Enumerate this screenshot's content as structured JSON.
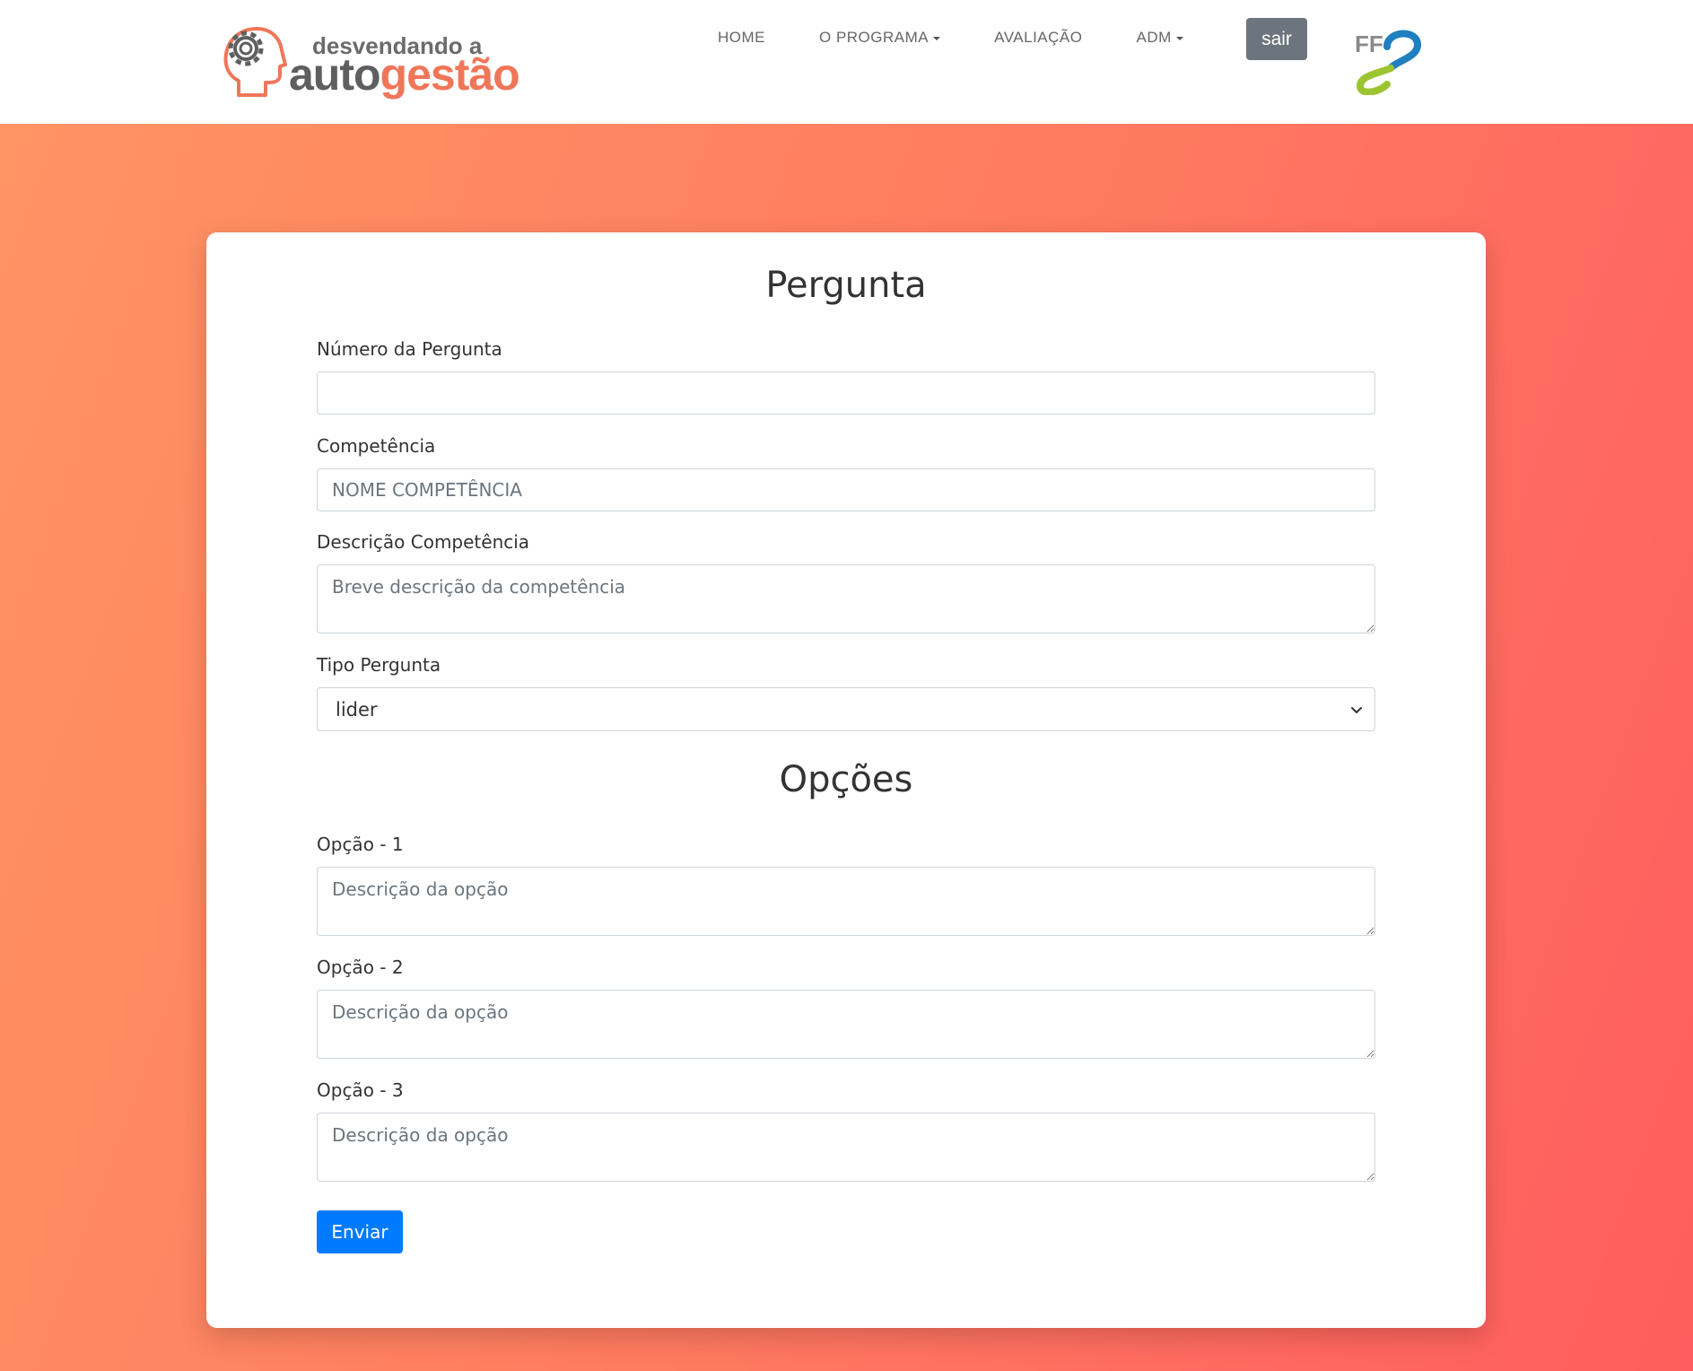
{
  "brand": {
    "line1": "desvendando a",
    "line2_a": "auto",
    "line2_b": "gestão",
    "accent_color": "#f0765a"
  },
  "nav": {
    "items": [
      {
        "label": "HOME",
        "dropdown": false
      },
      {
        "label": "O PROGRAMA",
        "dropdown": true
      },
      {
        "label": "AVALIAÇÃO",
        "dropdown": false
      },
      {
        "label": "ADM",
        "dropdown": true
      }
    ],
    "logout_label": "sair",
    "partner_logo_text": "FF"
  },
  "form": {
    "title": "Pergunta",
    "numero": {
      "label": "Número da Pergunta",
      "value": "",
      "placeholder": ""
    },
    "competencia": {
      "label": "Competência",
      "placeholder": "NOME COMPETÊNCIA"
    },
    "descricao": {
      "label": "Descrição Competência",
      "placeholder": "Breve descrição da competência"
    },
    "tipo": {
      "label": "Tipo Pergunta",
      "selected": "lider"
    },
    "options_title": "Opções",
    "options": [
      {
        "label": "Opção - 1",
        "placeholder": "Descrição da opção"
      },
      {
        "label": "Opção - 2",
        "placeholder": "Descrição da opção"
      },
      {
        "label": "Opção - 3",
        "placeholder": "Descrição da opção"
      }
    ],
    "submit_label": "Enviar"
  },
  "colors": {
    "primary_button": "#007bff",
    "secondary_button": "#6c757d",
    "gradient_start": "#ff9464",
    "gradient_end": "#ff5d5f"
  }
}
